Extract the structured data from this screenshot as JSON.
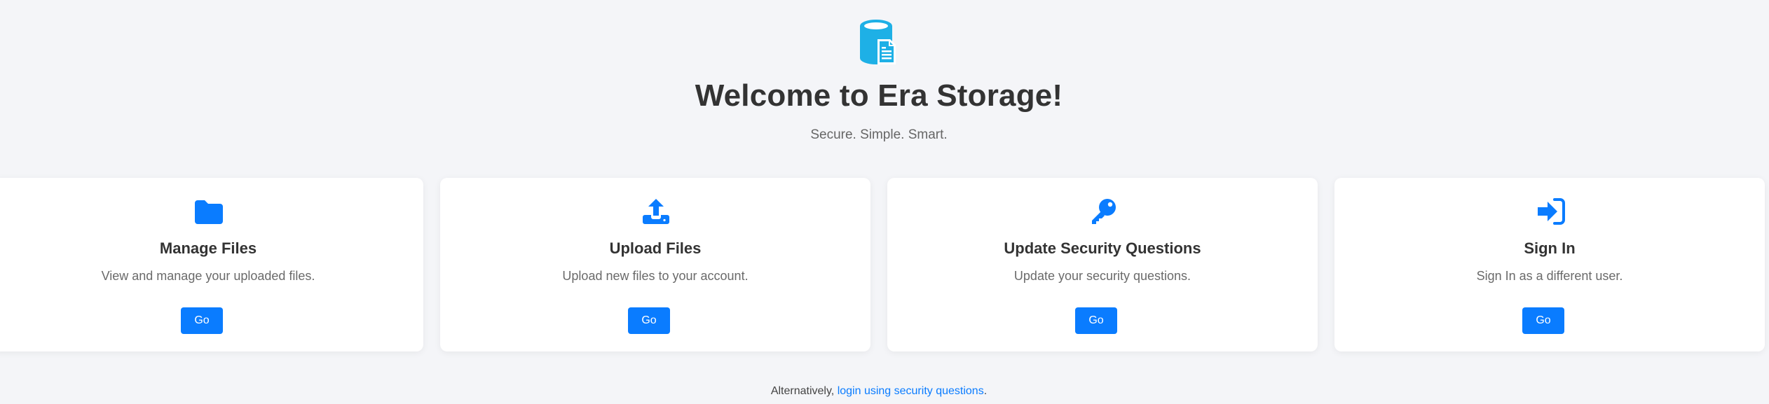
{
  "header": {
    "logo_icon": "storage-document-icon",
    "title": "Welcome to Era Storage!",
    "subtitle": "Secure. Simple. Smart."
  },
  "cards": [
    {
      "icon": "folder-icon",
      "title": "Manage Files",
      "description": "View and manage your uploaded files.",
      "button_label": "Go"
    },
    {
      "icon": "upload-icon",
      "title": "Upload Files",
      "description": "Upload new files to your account.",
      "button_label": "Go"
    },
    {
      "icon": "key-icon",
      "title": "Update Security Questions",
      "description": "Update your security questions.",
      "button_label": "Go"
    },
    {
      "icon": "sign-in-icon",
      "title": "Sign In",
      "description": "Sign In as a different user.",
      "button_label": "Go"
    }
  ],
  "footer": {
    "prefix": "Alternatively,",
    "link_text": "login using security questions",
    "suffix": "."
  },
  "colors": {
    "accent": "#0a7cff",
    "logo": "#1eb0e6",
    "background": "#f4f5f8"
  }
}
